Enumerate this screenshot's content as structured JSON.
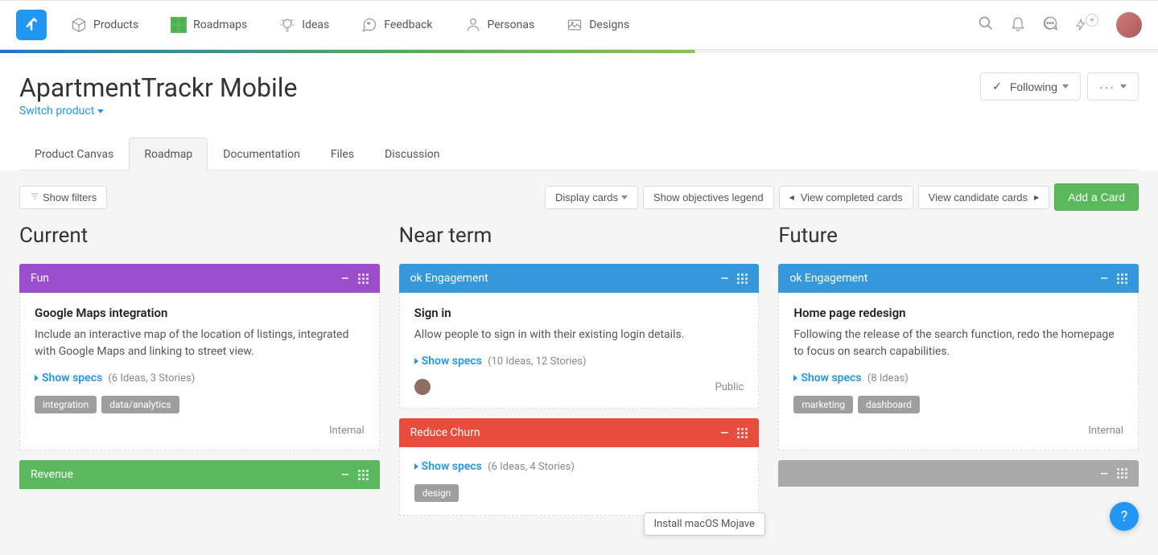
{
  "nav": {
    "items": [
      "Products",
      "Roadmaps",
      "Ideas",
      "Feedback",
      "Personas",
      "Designs"
    ]
  },
  "page": {
    "title": "ApartmentTrackr Mobile",
    "switch_label": "Switch product",
    "following_label": "Following"
  },
  "tabs": [
    "Product Canvas",
    "Roadmap",
    "Documentation",
    "Files",
    "Discussion"
  ],
  "active_tab": 1,
  "toolbar": {
    "filters_label": "Show filters",
    "display_cards": "Display cards",
    "objectives_legend": "Show objectives legend",
    "view_completed": "View completed cards",
    "view_candidate": "View candidate cards",
    "add_card": "Add a Card"
  },
  "columns": [
    {
      "title": "Current",
      "lanes": [
        {
          "color": "purple",
          "label": "Fun",
          "cards": [
            {
              "title": "Google Maps integration",
              "desc": "Include an interactive map of the location of listings, integrated with Google Maps and linking to street view.",
              "specs": "Show specs",
              "specs_meta": "(6 Ideas, 3 Stories)",
              "tags": [
                "integration",
                "data/analytics"
              ],
              "visibility": "Internal"
            }
          ]
        },
        {
          "color": "green",
          "label": "Revenue",
          "cards": []
        }
      ]
    },
    {
      "title": "Near term",
      "lanes": [
        {
          "color": "blue",
          "label": "ok Engagement",
          "cards": [
            {
              "title": "Sign in",
              "desc": "Allow people to sign in with their existing login details.",
              "specs": "Show specs",
              "specs_meta": "(10 Ideas, 12 Stories)",
              "has_avatar": true,
              "visibility": "Public"
            }
          ]
        },
        {
          "color": "red",
          "label": "Reduce Churn",
          "cards": [
            {
              "specs": "Show specs",
              "specs_meta": "(6 Ideas, 4 Stories)",
              "tags": [
                "design"
              ]
            }
          ]
        }
      ]
    },
    {
      "title": "Future",
      "lanes": [
        {
          "color": "blue",
          "label": "ok Engagement",
          "cards": [
            {
              "title": "Home page redesign",
              "desc": "Following the release of the search function, redo the homepage to focus on search capabilities.",
              "specs": "Show specs",
              "specs_meta": "(8 Ideas)",
              "tags": [
                "marketing",
                "dashboard"
              ],
              "visibility": "Internal"
            }
          ]
        },
        {
          "color": "grey",
          "label": "",
          "cards": []
        }
      ]
    }
  ],
  "tooltip": "Install macOS Mojave"
}
